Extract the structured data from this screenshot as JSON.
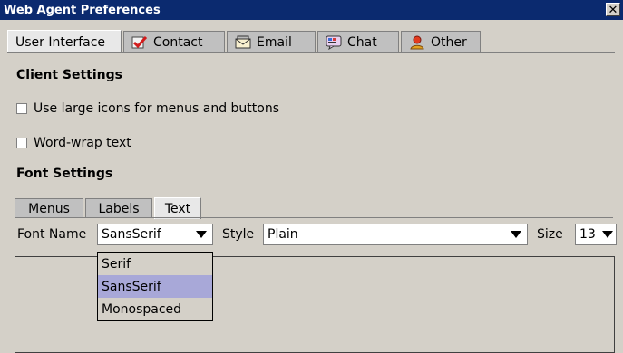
{
  "window": {
    "title": "Web Agent Preferences",
    "close_glyph": "✕"
  },
  "tabs": [
    {
      "label": "User Interface",
      "icon": "none"
    },
    {
      "label": "Contact",
      "icon": "checkmark-icon"
    },
    {
      "label": "Email",
      "icon": "email-icon"
    },
    {
      "label": "Chat",
      "icon": "chat-icon"
    },
    {
      "label": "Other",
      "icon": "person-icon"
    }
  ],
  "client_settings": {
    "title": "Client Settings",
    "opt1": "Use large icons for menus and buttons",
    "opt2": "Word-wrap text"
  },
  "font_settings": {
    "title": "Font Settings",
    "subtabs": [
      "Menus",
      "Labels",
      "Text"
    ],
    "font_name_label": "Font Name",
    "font_name_value": "SansSerif",
    "style_label": "Style",
    "style_value": "Plain",
    "size_label": "Size",
    "size_value": "13",
    "dropdown_options": [
      "Serif",
      "SansSerif",
      "Monospaced"
    ]
  },
  "colors": {
    "titlebar": "#0b2a6f",
    "selection": "#a8a8d8",
    "window_bg": "#d4d0c8"
  }
}
